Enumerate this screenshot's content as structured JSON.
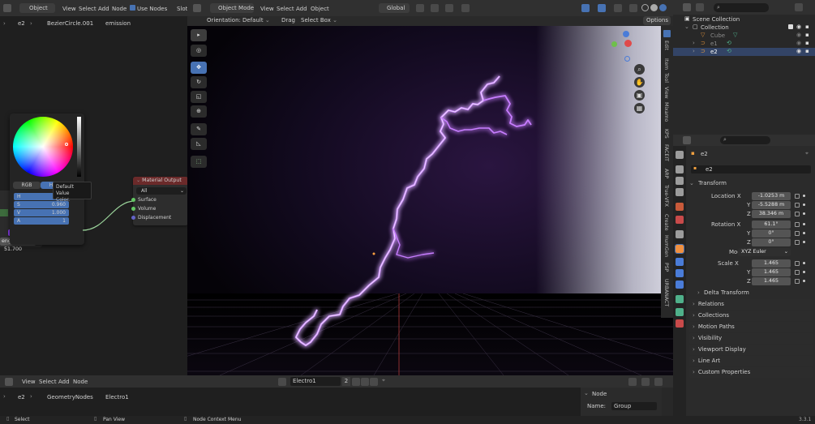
{
  "node_editor_top": {
    "mode": "Object",
    "menus": [
      "View",
      "Select",
      "Add",
      "Node"
    ],
    "use_nodes_label": "Use Nodes",
    "slot_label": "Slot",
    "breadcrumb": [
      "e2",
      "BezierCircle.001",
      "emission"
    ]
  },
  "color_picker": {
    "tabs": [
      "RGB",
      "HSV"
    ],
    "active_tab": "HSV",
    "fields": [
      {
        "label": "H",
        "value": ""
      },
      {
        "label": "S",
        "value": "0.960"
      },
      {
        "label": "V",
        "value": "1.000"
      },
      {
        "label": "A",
        "value": "1"
      }
    ],
    "swatch_color": "#8a3cf0",
    "tooltip_line1": "Default Value",
    "tooltip_line2": "Color.",
    "strength_label": "ength",
    "strength_value": "51.700"
  },
  "material_output": {
    "title": "Material Output",
    "target": "All",
    "sockets": [
      "Surface",
      "Volume",
      "Displacement"
    ],
    "header_color": "#6b2a2a"
  },
  "viewport_header": {
    "mode": "Object Mode",
    "menus": [
      "View",
      "Select",
      "Add",
      "Object"
    ],
    "orientation_label": "Global",
    "orientation_row": {
      "label": "Orientation:",
      "value": "Default",
      "drag_label": "Drag",
      "drag_value": "Select Box"
    },
    "options_label": "Options"
  },
  "sidebar_tabs": [
    "Edit",
    "Item",
    "Tool",
    "View",
    "Mixamo",
    "KPS",
    "FACEIT",
    "ARP",
    "True-VFX",
    "Create",
    "HumGen",
    "PSP",
    "URBANACT"
  ],
  "outliner": {
    "root": "Scene Collection",
    "collection": "Collection",
    "items": [
      {
        "name": "Cube",
        "dim": true
      },
      {
        "name": "e1",
        "dim": true
      },
      {
        "name": "e2",
        "dim": false
      }
    ]
  },
  "properties": {
    "object_name": "e2",
    "object_data": "e2",
    "transform_label": "Transform",
    "location": {
      "label": "Location X",
      "x": "-1.0253 m",
      "y": "-5.5288 m",
      "z": "38.346 m"
    },
    "rotation": {
      "label": "Rotation X",
      "x": "61.1°",
      "y": "0°",
      "z": "0°"
    },
    "mode_label": "Mode",
    "mode_value": "XYZ Euler",
    "scale": {
      "label": "Scale X",
      "x": "1.465",
      "y": "1.465",
      "z": "1.465"
    },
    "axis_y": "Y",
    "axis_z": "Z",
    "delta_transform": "Delta Transform",
    "sections": [
      "Relations",
      "Collections",
      "Motion Paths",
      "Visibility",
      "Viewport Display",
      "Line Art",
      "Custom Properties"
    ]
  },
  "node_editor_bottom": {
    "menus": [
      "View",
      "Select",
      "Add",
      "Node"
    ],
    "datablock": "Electro1",
    "users": "2",
    "breadcrumb": [
      "e2",
      "GeometryNodes",
      "Electro1"
    ],
    "node_panel_title": "Node",
    "name_label": "Name:",
    "name_value": "Group"
  },
  "status_bar": {
    "items": [
      "Select",
      "Pan View",
      "Node Context Menu"
    ],
    "version": "3.3.1"
  },
  "colors": {
    "lightning": "#c77dff",
    "selected_blue": "#4772b3"
  }
}
